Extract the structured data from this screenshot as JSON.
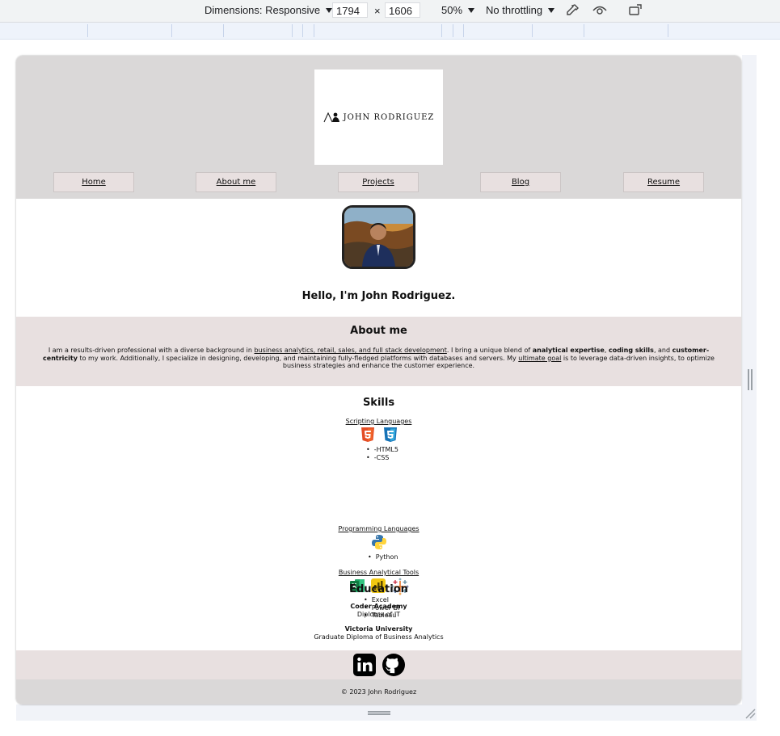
{
  "devtools": {
    "dimensions_label": "Dimensions: Responsive",
    "width": "1794",
    "times": "×",
    "height": "1606",
    "zoom": "50%",
    "throttle": "No throttling"
  },
  "site": {
    "logo_text": "JOHN RODRIGUEZ",
    "nav": [
      "Home",
      "About me",
      "Projects",
      "Blog",
      "Resume"
    ],
    "greeting": "Hello, I'm John Rodriguez.",
    "about": {
      "title": "About me",
      "p1": "I am a results-driven professional with a diverse background in ",
      "link1": "business analytics, retail, sales, and full stack development",
      "p2": ". I bring a unique blend of ",
      "b1": "analytical expertise",
      "p3": ", ",
      "b2": "coding skills",
      "p4": ", and ",
      "b3": "customer-centricity",
      "p5": " to my work. Additionally, I specialize in designing, developing, and maintaining fully-fledged platforms with databases and servers. My ",
      "link2": "ultimate goal",
      "p6": " is to leverage data-driven insights, to optimize business strategies and enhance the customer experience."
    },
    "skills": {
      "title": "Skills",
      "scripting": {
        "label": "Scripting Languages",
        "items": [
          "-HTML5",
          "-CSS"
        ]
      },
      "programming": {
        "label": "Programming Languages",
        "items": [
          "Python"
        ]
      },
      "bi": {
        "label": "Business Analytical Tools",
        "items": [
          "Excel",
          "Power BI",
          "Tableau"
        ]
      }
    },
    "education": {
      "title": "Education",
      "entries": [
        {
          "school": "Coder Academy",
          "degree": "Diploma of IT"
        },
        {
          "school": "Victoria University",
          "degree": "Graduate Diploma of Business Analytics"
        }
      ]
    },
    "social_icons": [
      "linkedin-icon",
      "github-icon"
    ],
    "footer": "© 2023 John Rodriguez"
  },
  "colors": {
    "header_bg": "#dad8d8",
    "section_bg": "#e8e0e0",
    "html5": "#e44d26",
    "css3": "#1572b6",
    "python_blue": "#3776ab",
    "python_yellow": "#ffd43b",
    "excel": "#1d6f42",
    "powerbi": "#f2c811"
  }
}
